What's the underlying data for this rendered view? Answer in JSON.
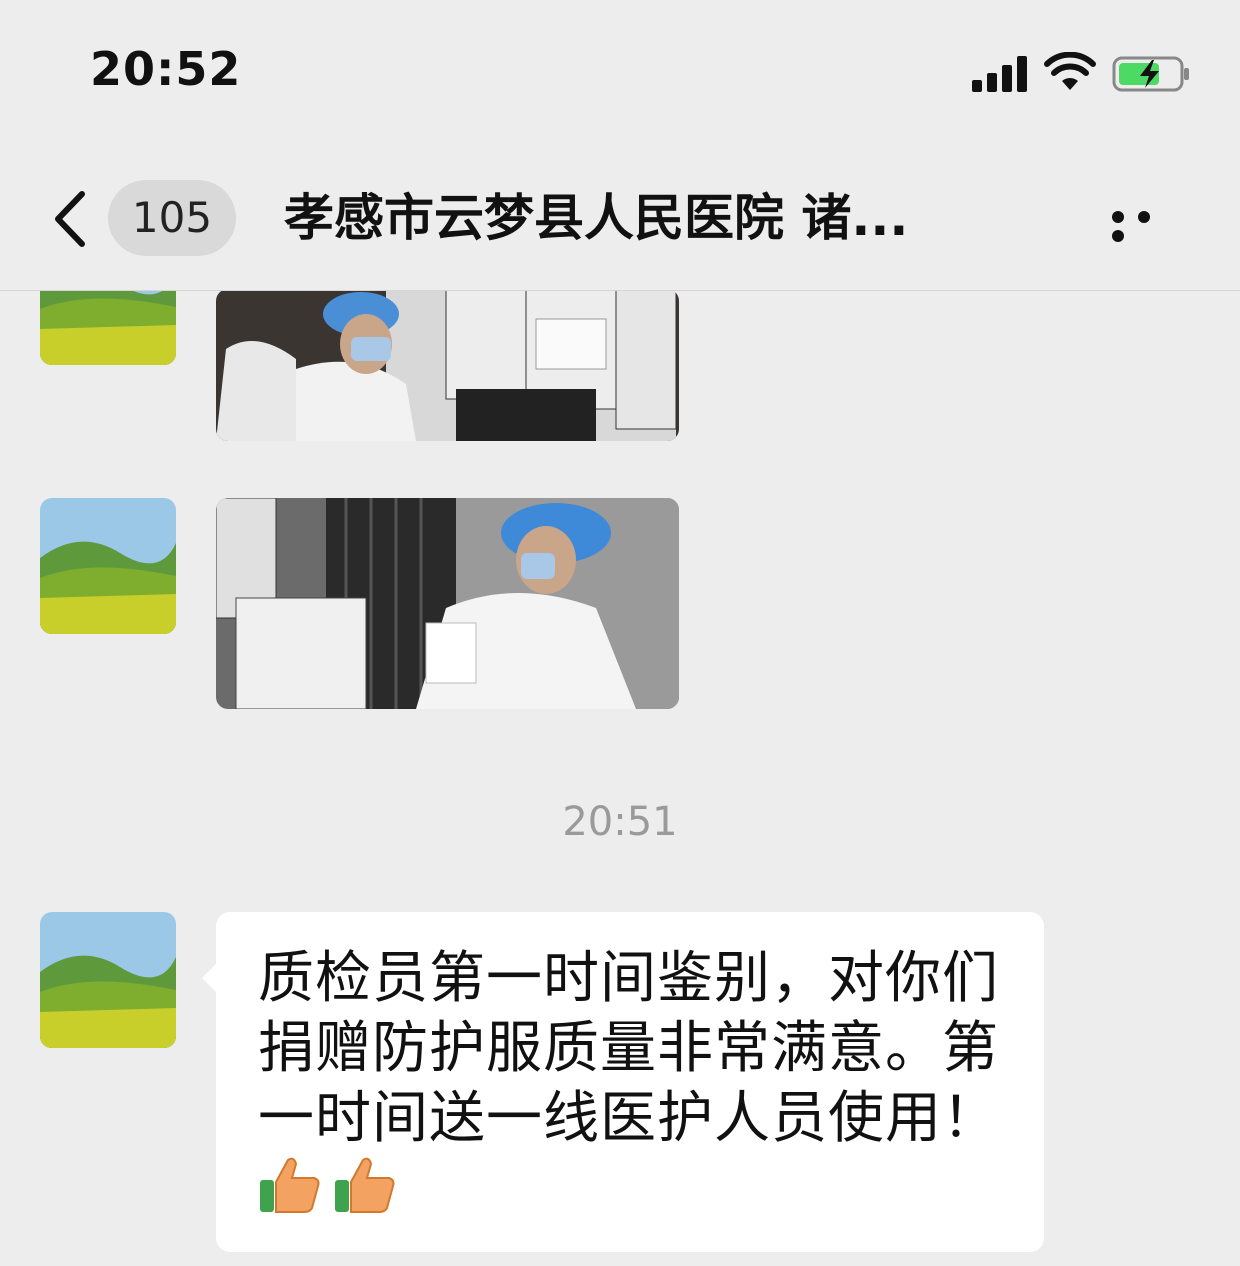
{
  "status_bar": {
    "time": "20:52"
  },
  "nav": {
    "unread_count": "105",
    "title": "孝感市云梦县人民医院 诸..."
  },
  "messages": [
    {
      "type": "image",
      "sender": "contact",
      "avatar_icon": "landscape-avatar-icon",
      "image_icon": "photo-staff-inspecting-boxes"
    },
    {
      "type": "image",
      "sender": "contact",
      "avatar_icon": "landscape-avatar-icon",
      "image_icon": "photo-staff-reading-document"
    },
    {
      "type": "timestamp",
      "text": "20:51"
    },
    {
      "type": "text",
      "sender": "contact",
      "avatar_icon": "landscape-avatar-icon",
      "text": "质检员第一时间鉴别，对你们捐赠防护服质量非常满意。第一时间送一线医护人员使用！",
      "emoji": [
        "thumbs-up-icon",
        "thumbs-up-icon"
      ]
    }
  ],
  "colors": {
    "background": "#ededed",
    "bubble": "#ffffff",
    "battery_green": "#4cd964"
  }
}
